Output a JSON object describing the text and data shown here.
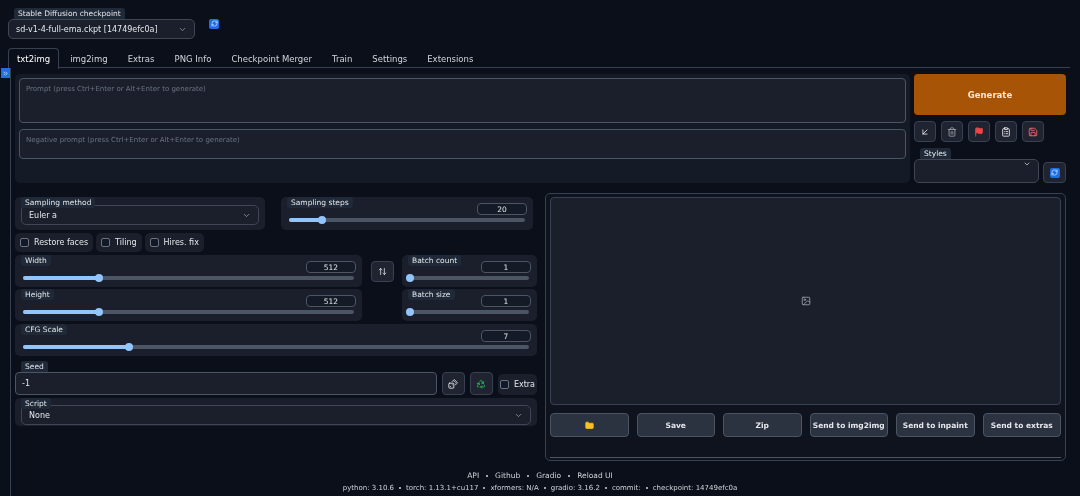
{
  "checkpoint": {
    "label": "Stable Diffusion checkpoint",
    "value": "sd-v1-4-full-ema.ckpt [14749efc0a]"
  },
  "tabs": [
    {
      "label": "txt2img",
      "selected": true
    },
    {
      "label": "img2img",
      "selected": false
    },
    {
      "label": "Extras",
      "selected": false
    },
    {
      "label": "PNG Info",
      "selected": false
    },
    {
      "label": "Checkpoint Merger",
      "selected": false
    },
    {
      "label": "Train",
      "selected": false
    },
    {
      "label": "Settings",
      "selected": false
    },
    {
      "label": "Extensions",
      "selected": false
    }
  ],
  "prompt": {
    "placeholder": "Prompt (press Ctrl+Enter or Alt+Enter to generate)"
  },
  "negative_prompt": {
    "placeholder": "Negative prompt (press Ctrl+Enter or Alt+Enter to generate)"
  },
  "generate_button": "Generate",
  "tool_buttons": [
    {
      "kind": "arrow"
    },
    {
      "kind": "trash"
    },
    {
      "kind": "flag"
    },
    {
      "kind": "clipboard"
    },
    {
      "kind": "save"
    }
  ],
  "styles": {
    "label": "Styles"
  },
  "sampling_method": {
    "label": "Sampling method",
    "value": "Euler a"
  },
  "sampling_steps": {
    "label": "Sampling steps",
    "value": "20",
    "level": 0.14
  },
  "checkboxes": [
    {
      "label": "Restore faces",
      "checked": false
    },
    {
      "label": "Tiling",
      "checked": false
    },
    {
      "label": "Hires. fix",
      "checked": false
    }
  ],
  "width": {
    "label": "Width",
    "value": "512",
    "level": 0.23
  },
  "height": {
    "label": "Height",
    "value": "512",
    "level": 0.23
  },
  "batch_count": {
    "label": "Batch count",
    "value": "1",
    "level": 0
  },
  "batch_size": {
    "label": "Batch size",
    "value": "1",
    "level": 0
  },
  "cfg_scale": {
    "label": "CFG Scale",
    "value": "7",
    "level": 0.21
  },
  "seed": {
    "label": "Seed",
    "value": "-1"
  },
  "extra": {
    "label": "Extra",
    "checked": false
  },
  "script": {
    "label": "Script",
    "value": "None"
  },
  "gallery_buttons": [
    {
      "kind": "folder"
    },
    {
      "kind": "text",
      "label": "Save"
    },
    {
      "kind": "text",
      "label": "Zip"
    },
    {
      "kind": "text",
      "label": "Send to img2img"
    },
    {
      "kind": "text",
      "label": "Send to inpaint"
    },
    {
      "kind": "text",
      "label": "Send to extras"
    }
  ],
  "footer": {
    "links": [
      "API",
      "Github",
      "Gradio",
      "Reload UI"
    ],
    "versions": [
      "python: 3.10.6",
      "torch: 1.13.1+cu117",
      "xformers: N/A",
      "gradio: 3.16.2",
      "commit:",
      "checkpoint: 14749efc0a"
    ]
  }
}
